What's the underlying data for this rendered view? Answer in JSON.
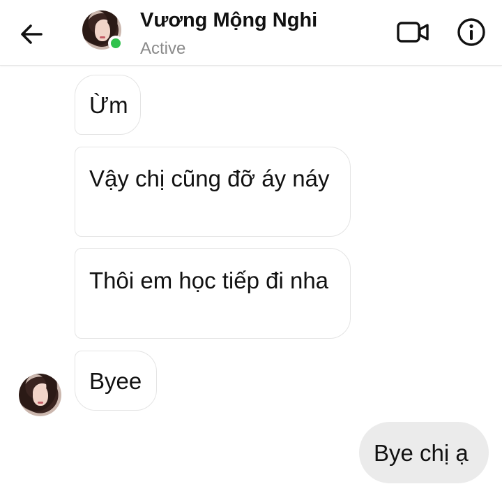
{
  "header": {
    "contact_name": "Vương Mộng Nghi",
    "status": "Active",
    "icons": {
      "back": "back-arrow-icon",
      "video": "video-call-icon",
      "info": "info-icon"
    },
    "online_color": "#31c24d"
  },
  "messages": [
    {
      "direction": "incoming",
      "text": "Ừm"
    },
    {
      "direction": "incoming",
      "text": "Vậy chị cũng đỡ áy náy"
    },
    {
      "direction": "incoming",
      "text": "Thôi em học tiếp đi nha"
    },
    {
      "direction": "incoming",
      "text": "Byee"
    },
    {
      "direction": "outgoing",
      "text": "Bye chị ạ"
    }
  ]
}
